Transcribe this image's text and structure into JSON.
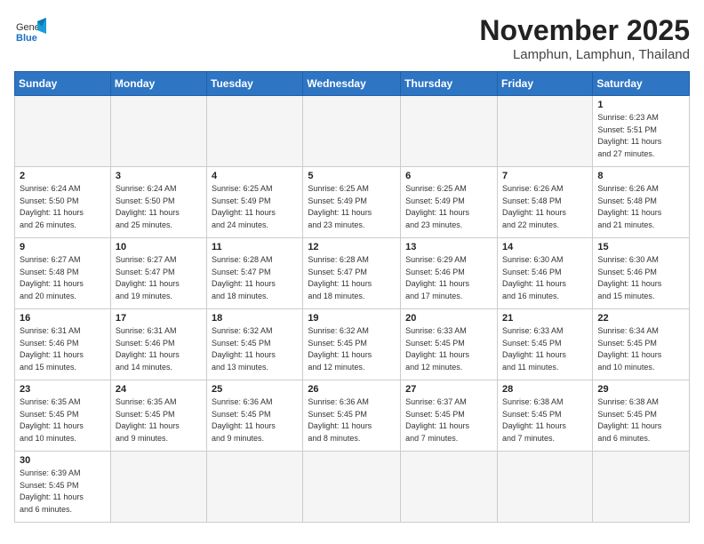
{
  "header": {
    "logo_general": "General",
    "logo_blue": "Blue",
    "month_title": "November 2025",
    "location": "Lamphun, Lamphun, Thailand"
  },
  "days_of_week": [
    "Sunday",
    "Monday",
    "Tuesday",
    "Wednesday",
    "Thursday",
    "Friday",
    "Saturday"
  ],
  "weeks": [
    [
      {
        "day": "",
        "info": ""
      },
      {
        "day": "",
        "info": ""
      },
      {
        "day": "",
        "info": ""
      },
      {
        "day": "",
        "info": ""
      },
      {
        "day": "",
        "info": ""
      },
      {
        "day": "",
        "info": ""
      },
      {
        "day": "1",
        "info": "Sunrise: 6:23 AM\nSunset: 5:51 PM\nDaylight: 11 hours\nand 27 minutes."
      }
    ],
    [
      {
        "day": "2",
        "info": "Sunrise: 6:24 AM\nSunset: 5:50 PM\nDaylight: 11 hours\nand 26 minutes."
      },
      {
        "day": "3",
        "info": "Sunrise: 6:24 AM\nSunset: 5:50 PM\nDaylight: 11 hours\nand 25 minutes."
      },
      {
        "day": "4",
        "info": "Sunrise: 6:25 AM\nSunset: 5:49 PM\nDaylight: 11 hours\nand 24 minutes."
      },
      {
        "day": "5",
        "info": "Sunrise: 6:25 AM\nSunset: 5:49 PM\nDaylight: 11 hours\nand 23 minutes."
      },
      {
        "day": "6",
        "info": "Sunrise: 6:25 AM\nSunset: 5:49 PM\nDaylight: 11 hours\nand 23 minutes."
      },
      {
        "day": "7",
        "info": "Sunrise: 6:26 AM\nSunset: 5:48 PM\nDaylight: 11 hours\nand 22 minutes."
      },
      {
        "day": "8",
        "info": "Sunrise: 6:26 AM\nSunset: 5:48 PM\nDaylight: 11 hours\nand 21 minutes."
      }
    ],
    [
      {
        "day": "9",
        "info": "Sunrise: 6:27 AM\nSunset: 5:48 PM\nDaylight: 11 hours\nand 20 minutes."
      },
      {
        "day": "10",
        "info": "Sunrise: 6:27 AM\nSunset: 5:47 PM\nDaylight: 11 hours\nand 19 minutes."
      },
      {
        "day": "11",
        "info": "Sunrise: 6:28 AM\nSunset: 5:47 PM\nDaylight: 11 hours\nand 18 minutes."
      },
      {
        "day": "12",
        "info": "Sunrise: 6:28 AM\nSunset: 5:47 PM\nDaylight: 11 hours\nand 18 minutes."
      },
      {
        "day": "13",
        "info": "Sunrise: 6:29 AM\nSunset: 5:46 PM\nDaylight: 11 hours\nand 17 minutes."
      },
      {
        "day": "14",
        "info": "Sunrise: 6:30 AM\nSunset: 5:46 PM\nDaylight: 11 hours\nand 16 minutes."
      },
      {
        "day": "15",
        "info": "Sunrise: 6:30 AM\nSunset: 5:46 PM\nDaylight: 11 hours\nand 15 minutes."
      }
    ],
    [
      {
        "day": "16",
        "info": "Sunrise: 6:31 AM\nSunset: 5:46 PM\nDaylight: 11 hours\nand 15 minutes."
      },
      {
        "day": "17",
        "info": "Sunrise: 6:31 AM\nSunset: 5:46 PM\nDaylight: 11 hours\nand 14 minutes."
      },
      {
        "day": "18",
        "info": "Sunrise: 6:32 AM\nSunset: 5:45 PM\nDaylight: 11 hours\nand 13 minutes."
      },
      {
        "day": "19",
        "info": "Sunrise: 6:32 AM\nSunset: 5:45 PM\nDaylight: 11 hours\nand 12 minutes."
      },
      {
        "day": "20",
        "info": "Sunrise: 6:33 AM\nSunset: 5:45 PM\nDaylight: 11 hours\nand 12 minutes."
      },
      {
        "day": "21",
        "info": "Sunrise: 6:33 AM\nSunset: 5:45 PM\nDaylight: 11 hours\nand 11 minutes."
      },
      {
        "day": "22",
        "info": "Sunrise: 6:34 AM\nSunset: 5:45 PM\nDaylight: 11 hours\nand 10 minutes."
      }
    ],
    [
      {
        "day": "23",
        "info": "Sunrise: 6:35 AM\nSunset: 5:45 PM\nDaylight: 11 hours\nand 10 minutes."
      },
      {
        "day": "24",
        "info": "Sunrise: 6:35 AM\nSunset: 5:45 PM\nDaylight: 11 hours\nand 9 minutes."
      },
      {
        "day": "25",
        "info": "Sunrise: 6:36 AM\nSunset: 5:45 PM\nDaylight: 11 hours\nand 9 minutes."
      },
      {
        "day": "26",
        "info": "Sunrise: 6:36 AM\nSunset: 5:45 PM\nDaylight: 11 hours\nand 8 minutes."
      },
      {
        "day": "27",
        "info": "Sunrise: 6:37 AM\nSunset: 5:45 PM\nDaylight: 11 hours\nand 7 minutes."
      },
      {
        "day": "28",
        "info": "Sunrise: 6:38 AM\nSunset: 5:45 PM\nDaylight: 11 hours\nand 7 minutes."
      },
      {
        "day": "29",
        "info": "Sunrise: 6:38 AM\nSunset: 5:45 PM\nDaylight: 11 hours\nand 6 minutes."
      }
    ],
    [
      {
        "day": "30",
        "info": "Sunrise: 6:39 AM\nSunset: 5:45 PM\nDaylight: 11 hours\nand 6 minutes."
      },
      {
        "day": "",
        "info": ""
      },
      {
        "day": "",
        "info": ""
      },
      {
        "day": "",
        "info": ""
      },
      {
        "day": "",
        "info": ""
      },
      {
        "day": "",
        "info": ""
      },
      {
        "day": "",
        "info": ""
      }
    ]
  ]
}
